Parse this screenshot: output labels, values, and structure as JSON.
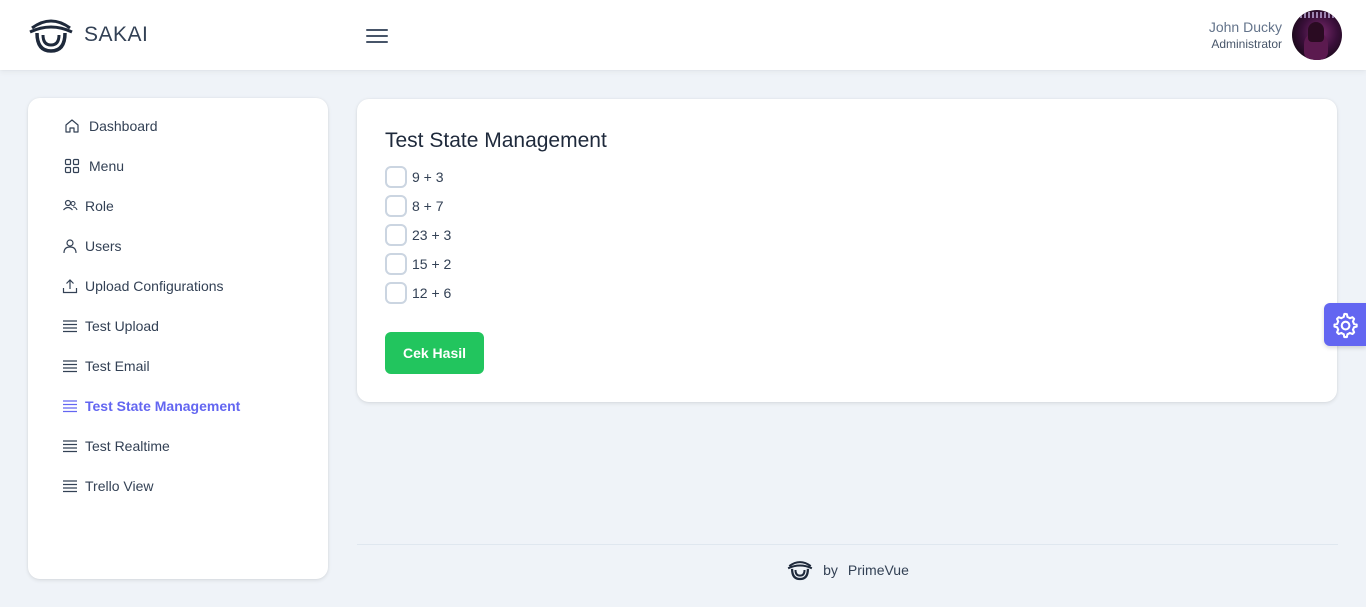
{
  "app": {
    "name": "SAKAI"
  },
  "user": {
    "name": "John Ducky",
    "role": "Administrator"
  },
  "sidebar": {
    "items": [
      {
        "label": "Dashboard",
        "icon": "home-icon"
      },
      {
        "label": "Menu",
        "icon": "th-large-icon"
      },
      {
        "label": "Role",
        "icon": "users-icon"
      },
      {
        "label": "Users",
        "icon": "user-icon"
      },
      {
        "label": "Upload Configurations",
        "icon": "upload-icon"
      },
      {
        "label": "Test Upload",
        "icon": "list-icon"
      },
      {
        "label": "Test Email",
        "icon": "list-icon"
      },
      {
        "label": "Test State Management",
        "icon": "list-icon",
        "active": true
      },
      {
        "label": "Test Realtime",
        "icon": "list-icon"
      },
      {
        "label": "Trello View",
        "icon": "list-icon"
      }
    ]
  },
  "main": {
    "title": "Test State Management",
    "options": [
      {
        "label": "9 + 3",
        "checked": false
      },
      {
        "label": "8 + 7",
        "checked": false
      },
      {
        "label": "23 + 3",
        "checked": false
      },
      {
        "label": "15 + 2",
        "checked": false
      },
      {
        "label": "12 + 6",
        "checked": false
      }
    ],
    "submit_label": "Cek Hasil"
  },
  "footer": {
    "by": "by",
    "brand": "PrimeVue"
  },
  "colors": {
    "primary": "#6366f1",
    "success": "#22c55e",
    "background": "#eff3f8"
  }
}
